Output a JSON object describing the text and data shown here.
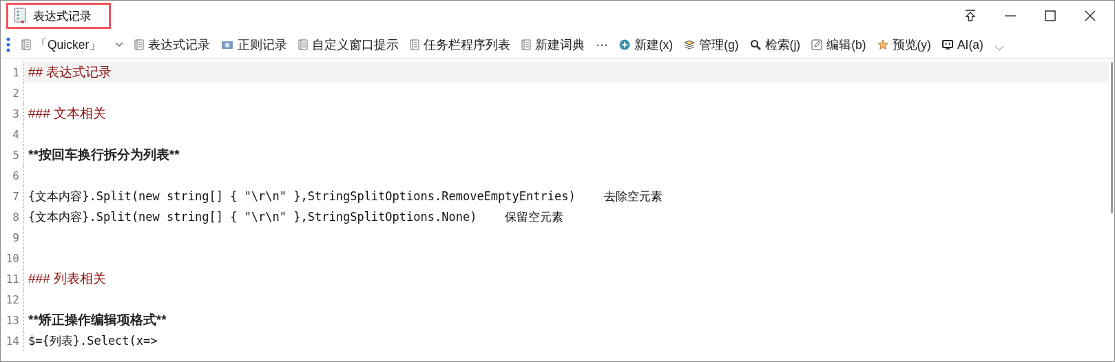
{
  "window": {
    "title": "表达式记录"
  },
  "toolbar": {
    "items": [
      {
        "label": "「Quicker」",
        "kind": "doc",
        "dropdown": true
      },
      {
        "label": "表达式记录",
        "kind": "doc",
        "dropdown": false
      },
      {
        "label": "正则记录",
        "kind": "photo",
        "dropdown": false
      },
      {
        "label": "自定义窗口提示",
        "kind": "doc",
        "dropdown": false
      },
      {
        "label": "任务栏程序列表",
        "kind": "doc",
        "dropdown": false
      },
      {
        "label": "新建词典",
        "kind": "doc",
        "dropdown": false
      },
      {
        "label": "⋯",
        "kind": "more",
        "dropdown": false
      },
      {
        "label": "新建(x)",
        "kind": "plus",
        "dropdown": false
      },
      {
        "label": "管理(g)",
        "kind": "layers",
        "dropdown": false
      },
      {
        "label": "检索(j)",
        "kind": "search",
        "dropdown": false
      },
      {
        "label": "编辑(b)",
        "kind": "edit",
        "dropdown": false
      },
      {
        "label": "预览(y)",
        "kind": "star",
        "dropdown": false
      },
      {
        "label": "AI(a)",
        "kind": "monitor",
        "dropdown": false
      }
    ]
  },
  "editor": {
    "lines": [
      {
        "number": "1",
        "kind": "heading",
        "text": "## 表达式记录",
        "current": true
      },
      {
        "number": "2",
        "kind": "blank",
        "current": false
      },
      {
        "number": "3",
        "kind": "heading",
        "text": "### 文本相关",
        "current": false
      },
      {
        "number": "4",
        "kind": "blank",
        "current": false
      },
      {
        "number": "5",
        "kind": "bold",
        "text": "**按回车换行拆分为列表**",
        "current": false
      },
      {
        "number": "6",
        "kind": "blank",
        "current": false
      },
      {
        "number": "7",
        "kind": "code",
        "text": "{文本内容}.Split(new string[] { \"\\r\\n\" },StringSplitOptions.RemoveEmptyEntries)    去除空元素",
        "current": false
      },
      {
        "number": "8",
        "kind": "code",
        "text": "{文本内容}.Split(new string[] { \"\\r\\n\" },StringSplitOptions.None)    保留空元素",
        "current": false
      },
      {
        "number": "9",
        "kind": "blank",
        "current": false
      },
      {
        "number": "10",
        "kind": "blank",
        "current": false
      },
      {
        "number": "11",
        "kind": "heading",
        "text": "### 列表相关",
        "current": false
      },
      {
        "number": "12",
        "kind": "blank",
        "current": false
      },
      {
        "number": "13",
        "kind": "bold",
        "text": "**矫正操作编辑项格式**",
        "current": false
      },
      {
        "number": "14",
        "kind": "code",
        "text": "$={列表}.Select(x=>",
        "current": false
      }
    ]
  }
}
